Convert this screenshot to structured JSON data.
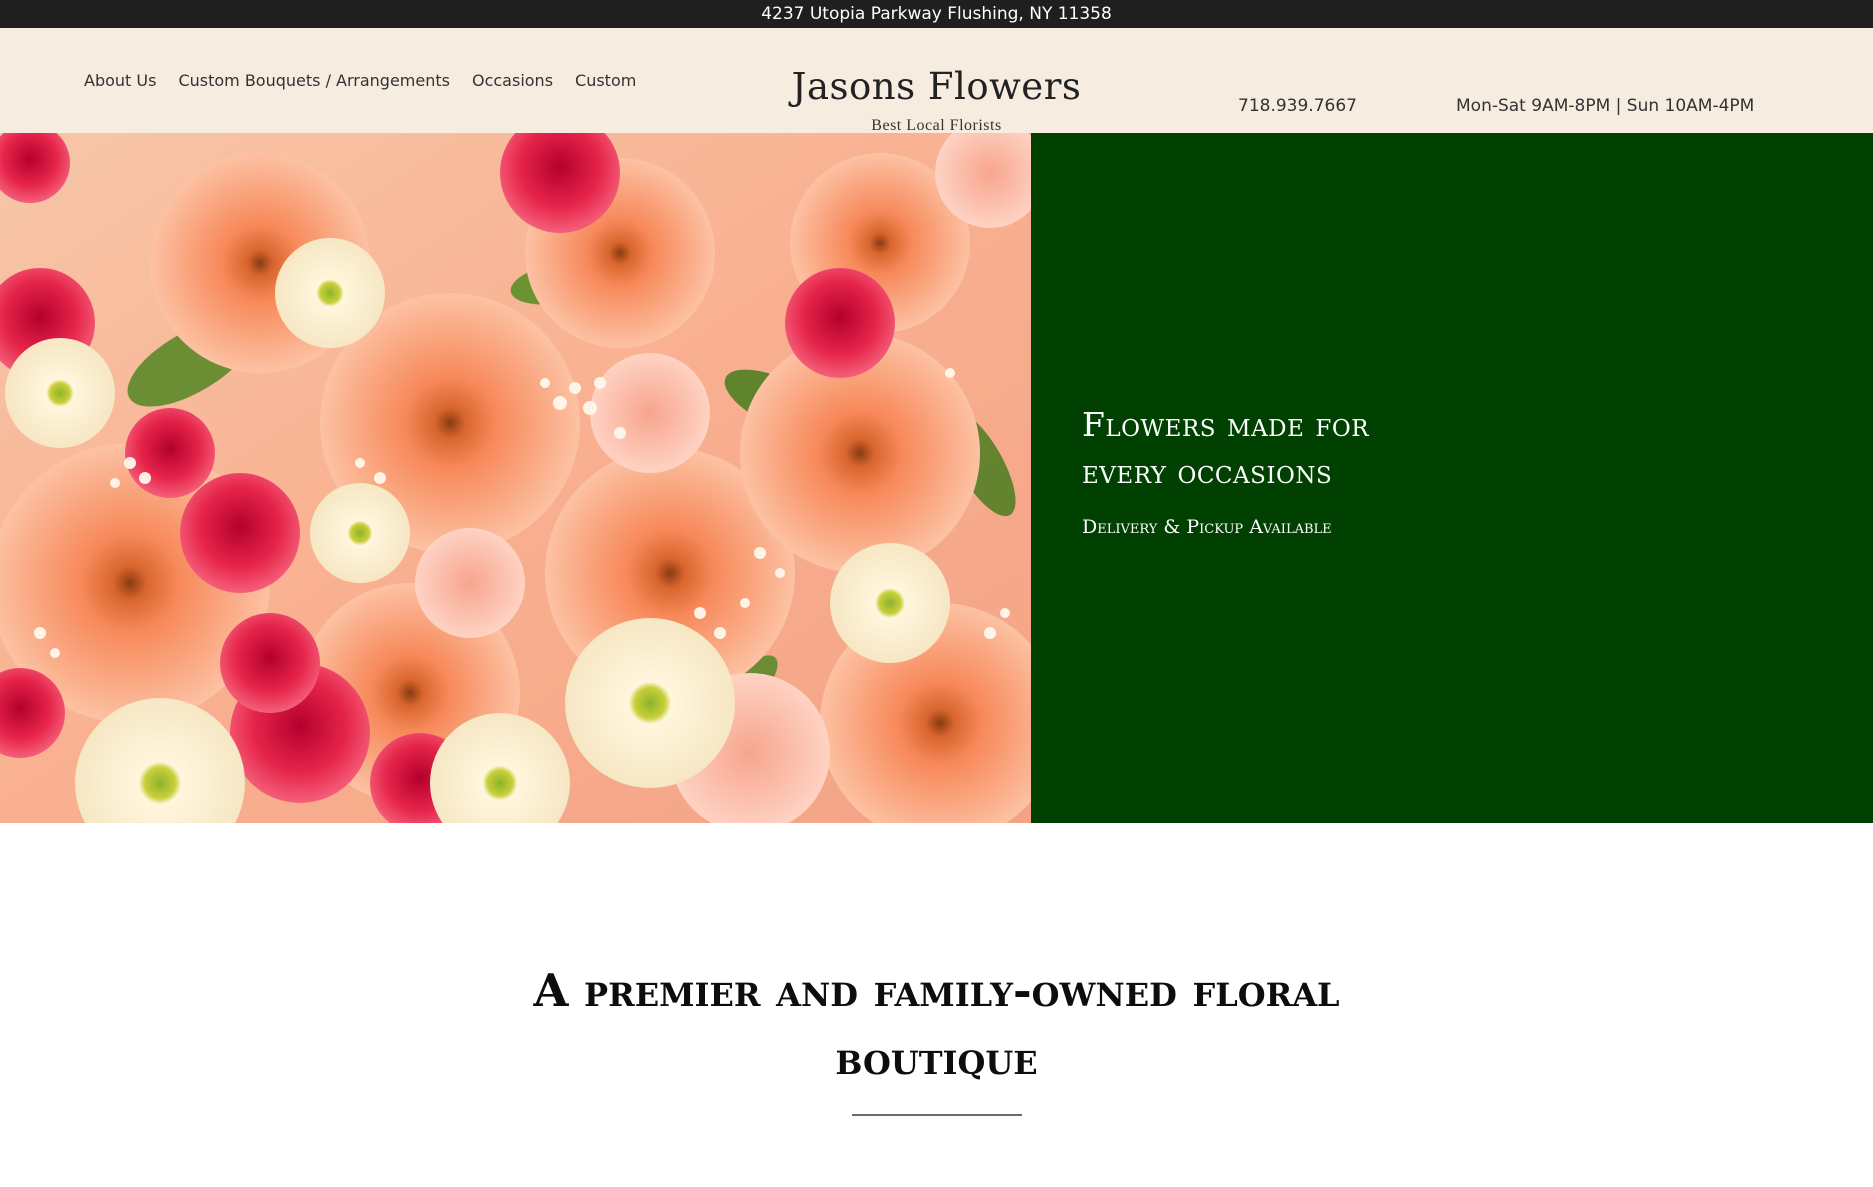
{
  "topbar": {
    "address": "4237 Utopia Parkway Flushing, NY 11358"
  },
  "nav": {
    "items": [
      {
        "label": "About Us"
      },
      {
        "label": "Custom Bouquets / Arrangements"
      },
      {
        "label": "Occasions"
      },
      {
        "label": "Custom"
      }
    ]
  },
  "brand": {
    "title": "Jasons Flowers",
    "subtitle": "Best Local Florists"
  },
  "contact": {
    "phone": "718.939.7667",
    "hours": "Mon-Sat 9AM-8PM | Sun 10AM-4PM"
  },
  "hero": {
    "heading_line1": "Flowers made for",
    "heading_line2": "every occasions",
    "subheading": "Delivery & Pickup Available"
  },
  "intro": {
    "title": "A premier and family-owned floral boutique"
  },
  "colors": {
    "topbar_bg": "#1f1f1f",
    "header_bg": "#f6ece0",
    "hero_panel_bg": "#004000"
  }
}
